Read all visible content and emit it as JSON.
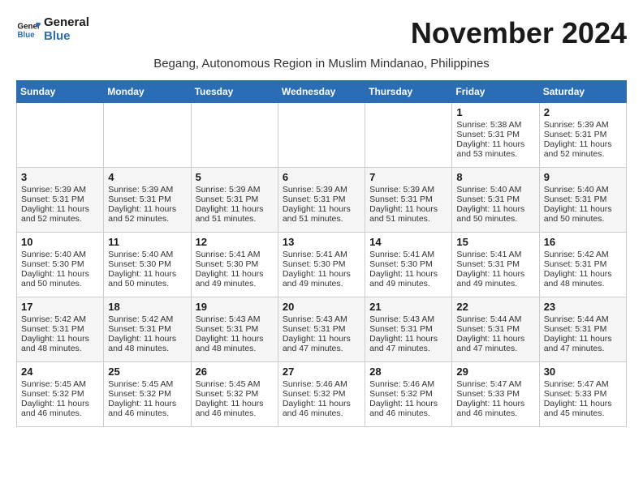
{
  "logo": {
    "line1": "General",
    "line2": "Blue"
  },
  "title": "November 2024",
  "subtitle": "Begang, Autonomous Region in Muslim Mindanao, Philippines",
  "headers": [
    "Sunday",
    "Monday",
    "Tuesday",
    "Wednesday",
    "Thursday",
    "Friday",
    "Saturday"
  ],
  "weeks": [
    [
      {
        "day": "",
        "info": ""
      },
      {
        "day": "",
        "info": ""
      },
      {
        "day": "",
        "info": ""
      },
      {
        "day": "",
        "info": ""
      },
      {
        "day": "",
        "info": ""
      },
      {
        "day": "1",
        "info": "Sunrise: 5:38 AM\nSunset: 5:31 PM\nDaylight: 11 hours and 53 minutes."
      },
      {
        "day": "2",
        "info": "Sunrise: 5:39 AM\nSunset: 5:31 PM\nDaylight: 11 hours and 52 minutes."
      }
    ],
    [
      {
        "day": "3",
        "info": "Sunrise: 5:39 AM\nSunset: 5:31 PM\nDaylight: 11 hours and 52 minutes."
      },
      {
        "day": "4",
        "info": "Sunrise: 5:39 AM\nSunset: 5:31 PM\nDaylight: 11 hours and 52 minutes."
      },
      {
        "day": "5",
        "info": "Sunrise: 5:39 AM\nSunset: 5:31 PM\nDaylight: 11 hours and 51 minutes."
      },
      {
        "day": "6",
        "info": "Sunrise: 5:39 AM\nSunset: 5:31 PM\nDaylight: 11 hours and 51 minutes."
      },
      {
        "day": "7",
        "info": "Sunrise: 5:39 AM\nSunset: 5:31 PM\nDaylight: 11 hours and 51 minutes."
      },
      {
        "day": "8",
        "info": "Sunrise: 5:40 AM\nSunset: 5:31 PM\nDaylight: 11 hours and 50 minutes."
      },
      {
        "day": "9",
        "info": "Sunrise: 5:40 AM\nSunset: 5:31 PM\nDaylight: 11 hours and 50 minutes."
      }
    ],
    [
      {
        "day": "10",
        "info": "Sunrise: 5:40 AM\nSunset: 5:30 PM\nDaylight: 11 hours and 50 minutes."
      },
      {
        "day": "11",
        "info": "Sunrise: 5:40 AM\nSunset: 5:30 PM\nDaylight: 11 hours and 50 minutes."
      },
      {
        "day": "12",
        "info": "Sunrise: 5:41 AM\nSunset: 5:30 PM\nDaylight: 11 hours and 49 minutes."
      },
      {
        "day": "13",
        "info": "Sunrise: 5:41 AM\nSunset: 5:30 PM\nDaylight: 11 hours and 49 minutes."
      },
      {
        "day": "14",
        "info": "Sunrise: 5:41 AM\nSunset: 5:30 PM\nDaylight: 11 hours and 49 minutes."
      },
      {
        "day": "15",
        "info": "Sunrise: 5:41 AM\nSunset: 5:31 PM\nDaylight: 11 hours and 49 minutes."
      },
      {
        "day": "16",
        "info": "Sunrise: 5:42 AM\nSunset: 5:31 PM\nDaylight: 11 hours and 48 minutes."
      }
    ],
    [
      {
        "day": "17",
        "info": "Sunrise: 5:42 AM\nSunset: 5:31 PM\nDaylight: 11 hours and 48 minutes."
      },
      {
        "day": "18",
        "info": "Sunrise: 5:42 AM\nSunset: 5:31 PM\nDaylight: 11 hours and 48 minutes."
      },
      {
        "day": "19",
        "info": "Sunrise: 5:43 AM\nSunset: 5:31 PM\nDaylight: 11 hours and 48 minutes."
      },
      {
        "day": "20",
        "info": "Sunrise: 5:43 AM\nSunset: 5:31 PM\nDaylight: 11 hours and 47 minutes."
      },
      {
        "day": "21",
        "info": "Sunrise: 5:43 AM\nSunset: 5:31 PM\nDaylight: 11 hours and 47 minutes."
      },
      {
        "day": "22",
        "info": "Sunrise: 5:44 AM\nSunset: 5:31 PM\nDaylight: 11 hours and 47 minutes."
      },
      {
        "day": "23",
        "info": "Sunrise: 5:44 AM\nSunset: 5:31 PM\nDaylight: 11 hours and 47 minutes."
      }
    ],
    [
      {
        "day": "24",
        "info": "Sunrise: 5:45 AM\nSunset: 5:32 PM\nDaylight: 11 hours and 46 minutes."
      },
      {
        "day": "25",
        "info": "Sunrise: 5:45 AM\nSunset: 5:32 PM\nDaylight: 11 hours and 46 minutes."
      },
      {
        "day": "26",
        "info": "Sunrise: 5:45 AM\nSunset: 5:32 PM\nDaylight: 11 hours and 46 minutes."
      },
      {
        "day": "27",
        "info": "Sunrise: 5:46 AM\nSunset: 5:32 PM\nDaylight: 11 hours and 46 minutes."
      },
      {
        "day": "28",
        "info": "Sunrise: 5:46 AM\nSunset: 5:32 PM\nDaylight: 11 hours and 46 minutes."
      },
      {
        "day": "29",
        "info": "Sunrise: 5:47 AM\nSunset: 5:33 PM\nDaylight: 11 hours and 46 minutes."
      },
      {
        "day": "30",
        "info": "Sunrise: 5:47 AM\nSunset: 5:33 PM\nDaylight: 11 hours and 45 minutes."
      }
    ]
  ]
}
